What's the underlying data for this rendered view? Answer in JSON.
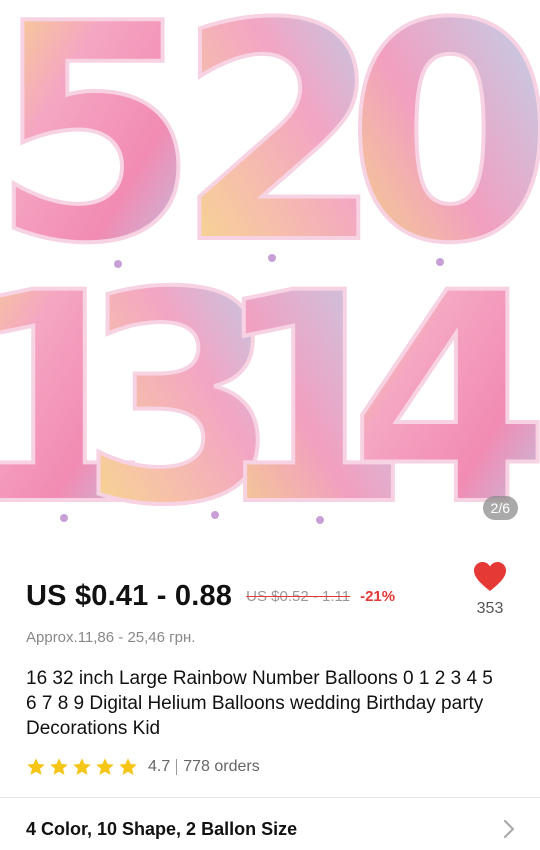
{
  "gallery": {
    "indicator": "2/6",
    "image_digits_top": [
      "5",
      "2",
      "0"
    ],
    "image_digits_bottom": [
      "1",
      "3",
      "1",
      "4"
    ]
  },
  "price": {
    "current": "US $0.41 - 0.88",
    "original": "US $0.52 - 1.11",
    "discount": "-21%",
    "approx": "Approx.11,86 - 25,46 грн."
  },
  "wishlist": {
    "count": "353",
    "icon": "heart-icon",
    "color": "#e53935"
  },
  "product": {
    "title": "16 32 inch Large Rainbow Number Balloons 0 1 2 3 4 5 6 7 8 9  Digital Helium Balloons wedding Birthday party Decorations Kid"
  },
  "rating": {
    "value": "4.7",
    "stars": 5,
    "orders": "778 orders",
    "star_color": "#f5c518"
  },
  "variants": {
    "summary": "4 Color, 10 Shape, 2 Ballon Size",
    "icon": "chevron-right-icon"
  }
}
